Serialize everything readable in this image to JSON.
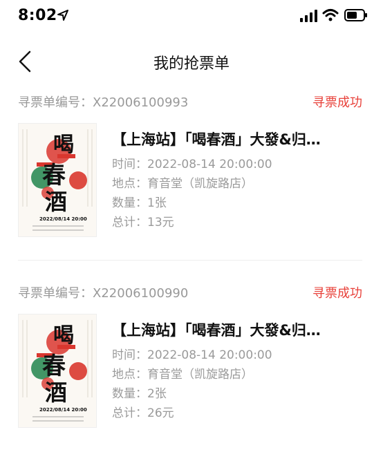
{
  "status_bar": {
    "time": "8:02"
  },
  "nav": {
    "title": "我的抢票单"
  },
  "labels": {
    "order_no_prefix": "寻票单编号：",
    "time": "时间：",
    "venue": "地点：",
    "quantity": "数量：",
    "total": "总计："
  },
  "orders": [
    {
      "order_no": "X22006100993",
      "status": "寻票成功",
      "title": "【上海站】「喝春酒」大發&归…",
      "time": "2022-08-14 20:00:00",
      "venue": "育音堂（凯旋路店）",
      "quantity": "1张",
      "total": "13元"
    },
    {
      "order_no": "X22006100990",
      "status": "寻票成功",
      "title": "【上海站】「喝春酒」大發&归…",
      "time": "2022-08-14 20:00:00",
      "venue": "育音堂（凯旋路店）",
      "quantity": "2张",
      "total": "26元"
    }
  ],
  "poster": {
    "calligraphy": [
      "喝",
      "春",
      "酒"
    ],
    "date_text": "2022/08/14 20:00"
  },
  "colors": {
    "accent": "#e8413a",
    "muted": "#999999",
    "title": "#111111"
  }
}
